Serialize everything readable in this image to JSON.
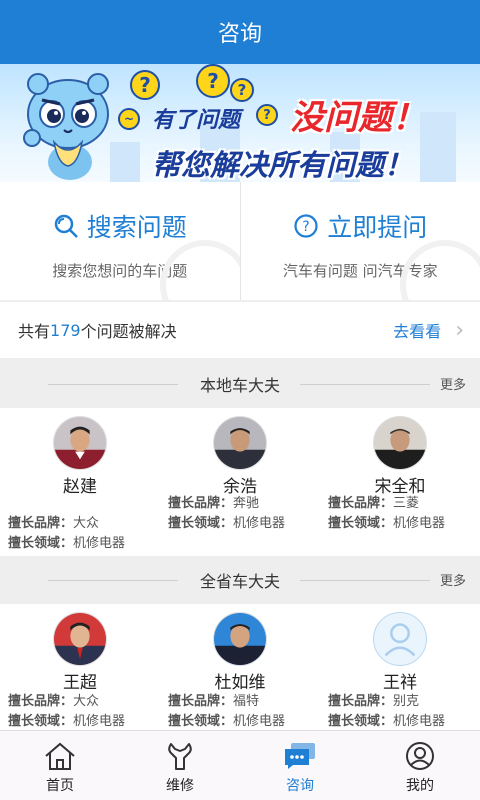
{
  "header": {
    "title": "咨询"
  },
  "banner": {
    "line1a": "有了问题",
    "line1b": "没问题！",
    "line2": "帮您解决所有问题！"
  },
  "actions": [
    {
      "title": "搜索问题",
      "subtitle": "搜索您想问的车问题",
      "icon": "search-icon"
    },
    {
      "title": "立即提问",
      "subtitle": "汽车有问题 问汽车专家",
      "icon": "question-icon"
    }
  ],
  "solved": {
    "prefix": "共有",
    "count": "179",
    "suffix": "个问题被解决",
    "link": "去看看"
  },
  "sections": [
    {
      "title": "本地车大夫",
      "more": "更多",
      "experts": [
        {
          "name": "赵建",
          "brand_label": "擅长品牌：",
          "brand": "大众",
          "field_label": "擅长领域：",
          "field": "机修电器"
        },
        {
          "name": "余浩",
          "brand_label": "擅长品牌：",
          "brand": "奔驰",
          "field_label": "擅长领域：",
          "field": "机修电器"
        },
        {
          "name": "宋全和",
          "brand_label": "擅长品牌：",
          "brand": "三菱",
          "field_label": "擅长领域：",
          "field": "机修电器"
        }
      ]
    },
    {
      "title": "全省车大夫",
      "more": "更多",
      "experts": [
        {
          "name": "王超",
          "brand_label": "擅长品牌：",
          "brand": "大众",
          "field_label": "擅长领域：",
          "field": "机修电器"
        },
        {
          "name": "杜如维",
          "brand_label": "擅长品牌：",
          "brand": "福特",
          "field_label": "擅长领域：",
          "field": "机修电器"
        },
        {
          "name": "王祥",
          "brand_label": "擅长品牌：",
          "brand": "别克",
          "field_label": "擅长领域：",
          "field": "机修电器"
        }
      ]
    }
  ],
  "tabs": [
    {
      "label": "首页",
      "icon": "home-icon"
    },
    {
      "label": "维修",
      "icon": "wrench-icon"
    },
    {
      "label": "咨询",
      "icon": "chat-icon",
      "active": true
    },
    {
      "label": "我的",
      "icon": "user-icon"
    }
  ],
  "colors": {
    "brand": "#1f7fd4",
    "accent_red": "#e8262b",
    "banner_text": "#1a3c9a"
  }
}
